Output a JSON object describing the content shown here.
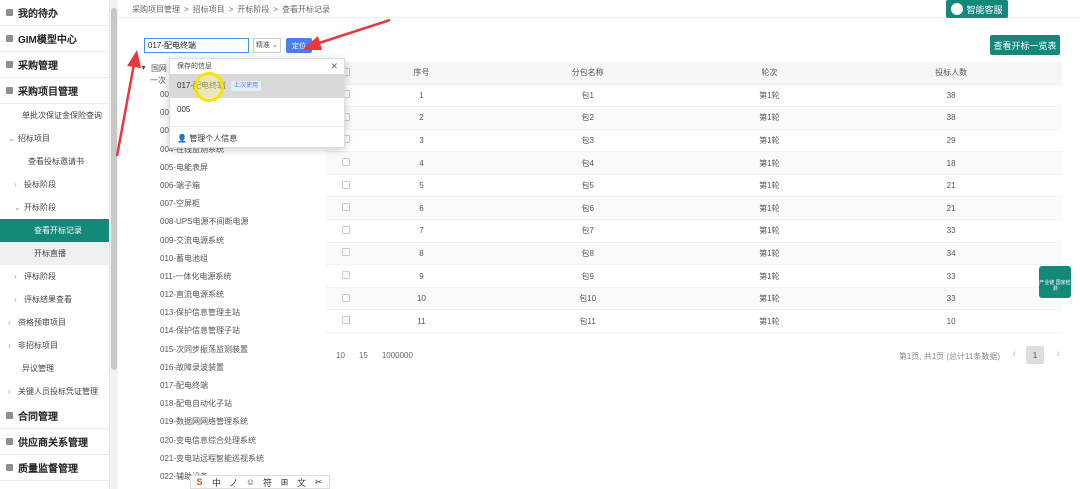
{
  "sidebar": {
    "items": [
      {
        "label": "我的待办",
        "level": 0
      },
      {
        "label": "GIM模型中心",
        "level": 0
      },
      {
        "label": "采购管理",
        "level": 0
      },
      {
        "label": "采购项目管理",
        "level": 0
      },
      {
        "label": "单批次保证金保险查询",
        "level": 1
      },
      {
        "label": "招标项目",
        "level": 1,
        "chevron": "⌄"
      },
      {
        "label": "查看投标邀请书",
        "level": 2
      },
      {
        "label": "投标阶段",
        "level": 2,
        "chevron": "›"
      },
      {
        "label": "开标阶段",
        "level": 2,
        "chevron": "⌄"
      },
      {
        "label": "查看开标记录",
        "level": 3,
        "active": true
      },
      {
        "label": "开标直播",
        "level": 3,
        "hover": true
      },
      {
        "label": "评标阶段",
        "level": 2,
        "chevron": "›"
      },
      {
        "label": "评标结果查看",
        "level": 2,
        "chevron": "›"
      },
      {
        "label": "资格预审项目",
        "level": 1,
        "chevron": "›"
      },
      {
        "label": "非招标项目",
        "level": 1,
        "chevron": "›"
      },
      {
        "label": "异议管理",
        "level": 1
      },
      {
        "label": "关键人员投标凭证管理",
        "level": 1,
        "chevron": "›"
      },
      {
        "label": "合同管理",
        "level": 0
      },
      {
        "label": "供应商关系管理",
        "level": 0
      },
      {
        "label": "质量监督管理",
        "level": 0
      }
    ]
  },
  "breadcrumb": [
    "采购项目管理",
    ">",
    "招标项目",
    ">",
    "开标阶段",
    ">",
    "查看开标记录"
  ],
  "customer_service": "智能客服",
  "search": {
    "value": "017-配电终端",
    "mode": "精准",
    "locate_label": "定位"
  },
  "view_all_label": "查看开标一览表",
  "dropdown": {
    "header": "保存的信息",
    "items": [
      {
        "label": "017-配电终端",
        "badge": "上次使用"
      },
      {
        "label": "005",
        "badge": ""
      }
    ],
    "manage_label": "管理个人信息"
  },
  "tree": {
    "root": "国网",
    "root_sub": "一次",
    "items": [
      "00",
      "00",
      "00",
      "004-在线监测系统",
      "005-电能表屏",
      "006-端子箱",
      "007-空屏柜",
      "008-UPS电源不间断电源",
      "009-交流电源系统",
      "010-蓄电池组",
      "011-一体化电源系统",
      "012-直流电源系统",
      "013-保护信息管理主站",
      "014-保护信息管理子站",
      "015-次同步振荡监测装置",
      "016-故障录波装置",
      "017-配电终端",
      "018-配电自动化子站",
      "019-数据网网络管理系统",
      "020-变电信息综合处理系统",
      "021-变电站远程智能巡视系统",
      "022-辅助设备..."
    ]
  },
  "table": {
    "headers": [
      "",
      "序号",
      "分包名称",
      "轮次",
      "投标人数"
    ],
    "rows": [
      [
        "1",
        "包1",
        "第1轮",
        "38"
      ],
      [
        "2",
        "包2",
        "第1轮",
        "38"
      ],
      [
        "3",
        "包3",
        "第1轮",
        "29"
      ],
      [
        "4",
        "包4",
        "第1轮",
        "18"
      ],
      [
        "5",
        "包5",
        "第1轮",
        "21"
      ],
      [
        "6",
        "包6",
        "第1轮",
        "21"
      ],
      [
        "7",
        "包7",
        "第1轮",
        "33"
      ],
      [
        "8",
        "包8",
        "第1轮",
        "34"
      ],
      [
        "9",
        "包9",
        "第1轮",
        "33"
      ],
      [
        "10",
        "包10",
        "第1轮",
        "33"
      ],
      [
        "11",
        "包11",
        "第1轮",
        "10"
      ]
    ]
  },
  "pager": {
    "sizes": [
      "10",
      "15",
      "1000000"
    ],
    "info": "第1页, 共1页 (总计11条数据)",
    "current": "1"
  },
  "float_widget": "产业链 国家检测",
  "ime": [
    "S",
    "中",
    "ノ",
    "☺",
    "符",
    "⊞",
    "⽂",
    "✂"
  ],
  "colors": {
    "primary": "#13897b",
    "accent_blue": "#4a7ee8",
    "arrow_red": "#e8383d"
  }
}
